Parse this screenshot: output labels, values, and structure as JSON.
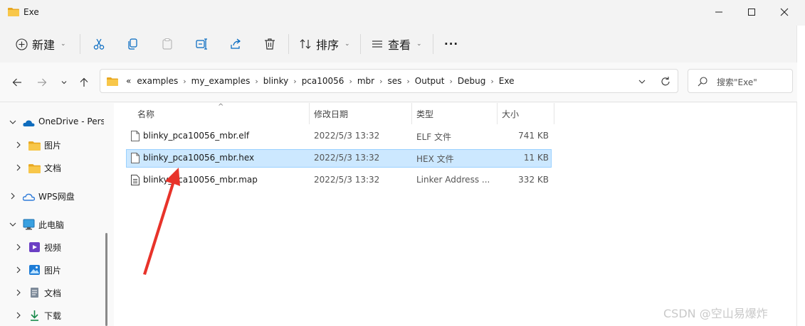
{
  "window": {
    "title": "Exe"
  },
  "toolbar": {
    "new_label": "新建",
    "sort_label": "排序",
    "view_label": "查看",
    "more_label": "···"
  },
  "address": {
    "overflow": "«",
    "crumbs": [
      "examples",
      "my_examples",
      "blinky",
      "pca10056",
      "mbr",
      "ses",
      "Output",
      "Debug",
      "Exe"
    ]
  },
  "search": {
    "placeholder": "搜索\"Exe\""
  },
  "nav": {
    "items": [
      {
        "label": "OneDrive - Pers"
      },
      {
        "label": "图片"
      },
      {
        "label": "文档"
      },
      {
        "label": "WPS网盘"
      },
      {
        "label": "此电脑"
      },
      {
        "label": "视频"
      },
      {
        "label": "图片"
      },
      {
        "label": "文档"
      },
      {
        "label": "下载"
      }
    ]
  },
  "columns": {
    "name": "名称",
    "date": "修改日期",
    "type": "类型",
    "size": "大小"
  },
  "files": [
    {
      "name": "blinky_pca10056_mbr.elf",
      "date": "2022/5/3 13:32",
      "type": "ELF 文件",
      "size": "741 KB",
      "selected": false
    },
    {
      "name": "blinky_pca10056_mbr.hex",
      "date": "2022/5/3 13:32",
      "type": "HEX 文件",
      "size": "11 KB",
      "selected": true
    },
    {
      "name": "blinky_pca10056_mbr.map",
      "date": "2022/5/3 13:32",
      "type": "Linker Address ...",
      "size": "332 KB",
      "selected": false
    }
  ],
  "watermark": "CSDN @空山易爆炸",
  "colors": {
    "selection_bg": "#cce8ff",
    "selection_border": "#99d1ff",
    "arrow": "#e8332a",
    "folder": "#f5c342",
    "onedrive": "#0f6cbd"
  }
}
